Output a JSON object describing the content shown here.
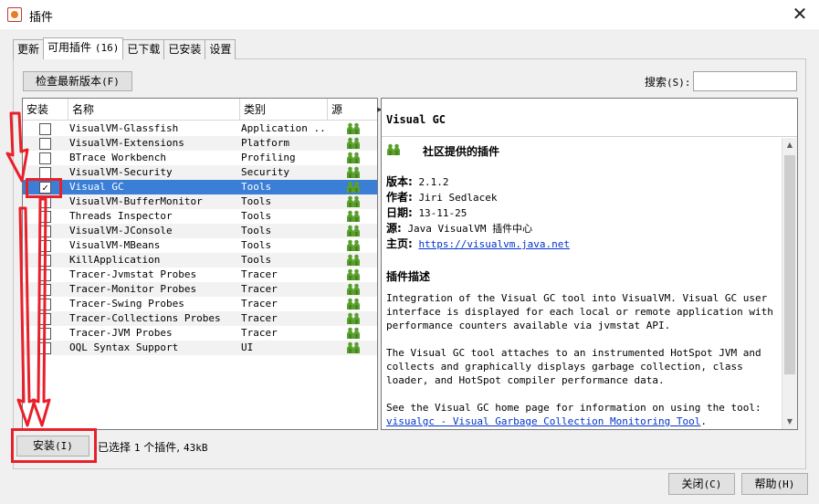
{
  "window": {
    "title": "插件",
    "close_glyph": "✕"
  },
  "tabs": [
    {
      "label": "更新",
      "count": ""
    },
    {
      "label": "可用插件",
      "count": "(16)"
    },
    {
      "label": "已下载",
      "count": ""
    },
    {
      "label": "已安装",
      "count": ""
    },
    {
      "label": "设置",
      "count": ""
    }
  ],
  "toolbar": {
    "check_latest_label": "检查最新版本",
    "check_latest_key": "(F)",
    "search_label": "搜索",
    "search_key": "(S):",
    "search_value": ""
  },
  "table": {
    "headers": {
      "install": "安装",
      "name": "名称",
      "category": "类别",
      "source": "源"
    },
    "rows": [
      {
        "name": "VisualVM-Glassfish",
        "category": "Application ...",
        "checked": false
      },
      {
        "name": "VisualVM-Extensions",
        "category": "Platform",
        "checked": false
      },
      {
        "name": "BTrace Workbench",
        "category": "Profiling",
        "checked": false
      },
      {
        "name": "VisualVM-Security",
        "category": "Security",
        "checked": false
      },
      {
        "name": "Visual GC",
        "category": "Tools",
        "checked": true
      },
      {
        "name": "VisualVM-BufferMonitor",
        "category": "Tools",
        "checked": false
      },
      {
        "name": "Threads Inspector",
        "category": "Tools",
        "checked": false
      },
      {
        "name": "VisualVM-JConsole",
        "category": "Tools",
        "checked": false
      },
      {
        "name": "VisualVM-MBeans",
        "category": "Tools",
        "checked": false
      },
      {
        "name": "KillApplication",
        "category": "Tools",
        "checked": false
      },
      {
        "name": "Tracer-Jvmstat Probes",
        "category": "Tracer",
        "checked": false
      },
      {
        "name": "Tracer-Monitor Probes",
        "category": "Tracer",
        "checked": false
      },
      {
        "name": "Tracer-Swing Probes",
        "category": "Tracer",
        "checked": false
      },
      {
        "name": "Tracer-Collections Probes",
        "category": "Tracer",
        "checked": false
      },
      {
        "name": "Tracer-JVM Probes",
        "category": "Tracer",
        "checked": false
      },
      {
        "name": "OQL Syntax Support",
        "category": "UI",
        "checked": false
      }
    ],
    "selected_index": 4,
    "source_icon": "community-people-icon"
  },
  "details": {
    "title": "Visual GC",
    "community_label": "社区提供的插件",
    "version_label": "版本:",
    "version_value": "2.1.2",
    "author_label": "作者:",
    "author_value": "Jiri Sedlacek",
    "date_label": "日期:",
    "date_value": "13-11-25",
    "source_label": "源:",
    "source_value": "Java VisualVM 插件中心",
    "homepage_label": "主页:",
    "homepage_value": "https://visualvm.java.net",
    "description_title": "插件描述",
    "para1": "Integration of the Visual GC tool into VisualVM. Visual GC user interface is displayed for each local or remote application with performance counters available via jvmstat API.",
    "para2": "The Visual GC tool attaches to an instrumented HotSpot JVM and collects and graphically displays garbage collection, class loader, and HotSpot compiler performance data.",
    "para3_text": "See the Visual GC home page for information on using the tool: ",
    "para3_link": "visualgc - Visual Garbage Collection Monitoring Tool",
    "para3_end": "."
  },
  "footer": {
    "install_label": "安装",
    "install_key": "(I)",
    "selected_prefix": "已选择",
    "selected_count": "1",
    "selected_middle": "个插件,",
    "selected_size": "43kB",
    "close_label": "关闭",
    "close_key": "(C)",
    "help_label": "帮助",
    "help_key": "(H)"
  },
  "colors": {
    "selection": "#3a7ed6",
    "annotation_red": "#e8202a",
    "link": "#0033cc",
    "people_icon": "#5aa02c"
  }
}
